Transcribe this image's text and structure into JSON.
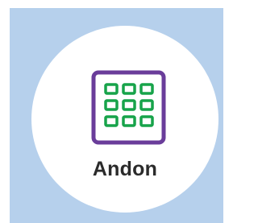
{
  "app_tile": {
    "label": "Andon",
    "icon": "andon-grid-icon"
  },
  "colors": {
    "background_frame": "#b6d0ec",
    "tile": "#ffffff",
    "icon_border": "#6a3d9a",
    "icon_cells": "#17a34a",
    "label": "#2b2b2b"
  }
}
